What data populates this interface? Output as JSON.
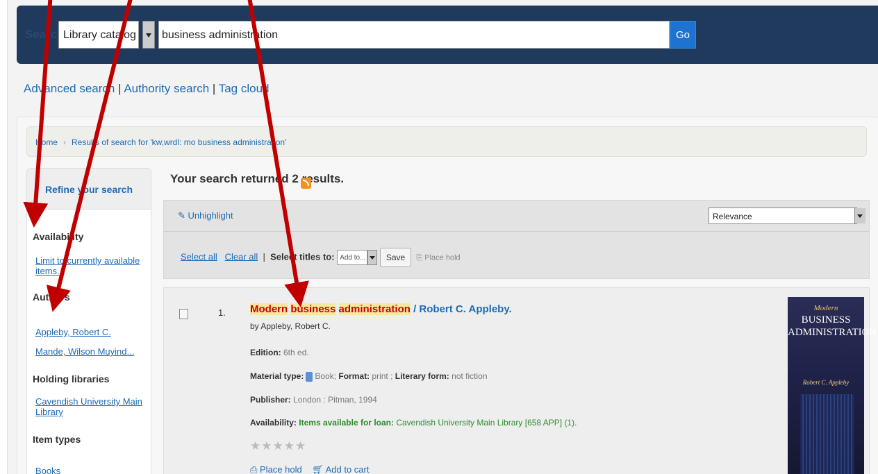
{
  "search": {
    "label": "Search",
    "catalog_option": "Library catalog",
    "query": "business administration",
    "go_label": "Go"
  },
  "links": {
    "advanced": "Advanced search",
    "authority": "Authority search",
    "tag_cloud": "Tag cloud",
    "sep": " | "
  },
  "breadcrumb": {
    "home": "Home",
    "results": "Results of search for 'kw,wrdl: mo business administration'"
  },
  "facets": {
    "heading": "Refine your search",
    "availability_title": "Availability",
    "availability_link": "Limit to currently available items.",
    "authors_title": "Authors",
    "authors": [
      "Appleby, Robert C.",
      "Mande, Wilson Muyind..."
    ],
    "holding_title": "Holding libraries",
    "holding": "Cavendish University Main Library",
    "item_types_title": "Item types",
    "item_types": "Books"
  },
  "results": {
    "summary": "Your search returned 2 results.",
    "unhighlight": "Unhighlight",
    "sort": "Relevance",
    "select_all": "Select all",
    "clear_all": "Clear all",
    "select_titles_label": "Select titles to:",
    "add_to": "Add to...",
    "save": "Save",
    "place_hold_toolbar": "Place hold"
  },
  "record": {
    "number": "1.",
    "title_w1": "Modern",
    "title_w2": "business",
    "title_w3": "administration",
    "title_rest": " / Robert C. Appleby.",
    "by": "by Appleby, Robert C.",
    "edition_label": "Edition:",
    "edition": "6th ed.",
    "material_label": "Material type:",
    "material": "Book;",
    "format_label": "Format:",
    "format": "print ;",
    "literary_label": "Literary form:",
    "literary": "not fiction",
    "publisher_label": "Publisher:",
    "publisher": "London : Pitman, 1994",
    "availability_label": "Availability:",
    "availability_status": "Items available for loan:",
    "availability_detail": "Cavendish University Main Library [658 APP] (1).",
    "rating": 0,
    "place_hold": "Place hold",
    "add_to_cart": "Add to cart"
  },
  "cover": {
    "small": "Modern",
    "title_line1": "BUSINESS",
    "title_line2": "ADMINISTRATION",
    "author": "Robert C. Appleby"
  },
  "colors": {
    "header_bg": "#1f3a5c",
    "link": "#1c6bb5",
    "go_button": "#1e73d0",
    "arrow": "#c00000",
    "highlight": "#f9e79f"
  }
}
